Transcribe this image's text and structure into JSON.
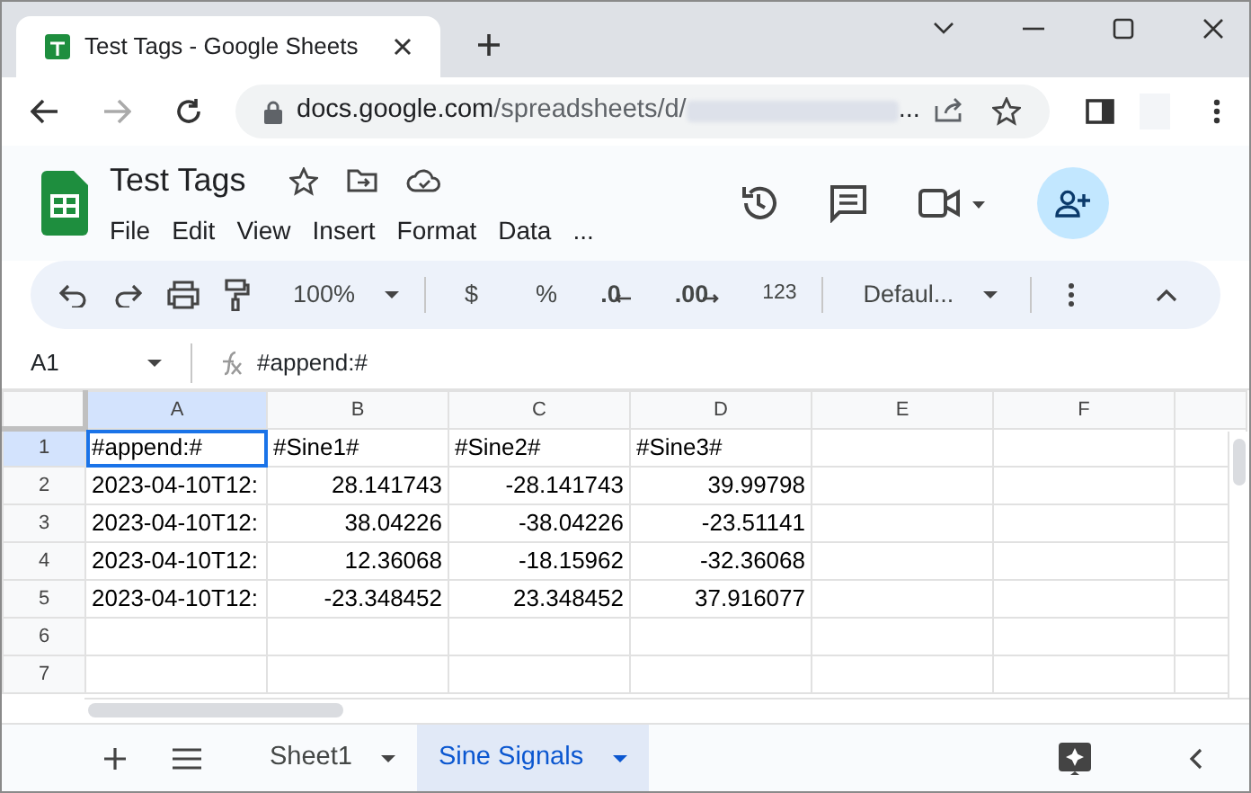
{
  "browser": {
    "tab_title": "Test Tags - Google Sheets",
    "url_host": "docs.google.com",
    "url_path": "/spreadsheets/d/",
    "url_ellipsis": "..."
  },
  "doc": {
    "title": "Test Tags",
    "menu": [
      "File",
      "Edit",
      "View",
      "Insert",
      "Format",
      "Data"
    ],
    "menu_more": "..."
  },
  "toolbar": {
    "zoom": "100%",
    "currency": "$",
    "percent": "%",
    "decrease_decimals": ".0",
    "increase_decimals": ".00",
    "number_format": "123",
    "font": "Defaul..."
  },
  "formula_bar": {
    "cell_ref": "A1",
    "formula": "#append:#"
  },
  "grid": {
    "columns": [
      {
        "label": "A",
        "selected": true
      },
      {
        "label": "B",
        "selected": false
      },
      {
        "label": "C",
        "selected": false
      },
      {
        "label": "D",
        "selected": false
      },
      {
        "label": "E",
        "selected": false
      },
      {
        "label": "F",
        "selected": false
      }
    ],
    "rows": [
      {
        "number": "1",
        "selected": true,
        "cells": [
          {
            "text": "#append:#",
            "kind": "text"
          },
          {
            "text": "#Sine1#",
            "kind": "text"
          },
          {
            "text": "#Sine2#",
            "kind": "text"
          },
          {
            "text": "#Sine3#",
            "kind": "text"
          }
        ]
      },
      {
        "number": "2",
        "selected": false,
        "cells": [
          {
            "text": "2023-04-10T12:",
            "kind": "text"
          },
          {
            "text": "28.141743",
            "kind": "number"
          },
          {
            "text": "-28.141743",
            "kind": "number"
          },
          {
            "text": "39.99798",
            "kind": "number"
          }
        ]
      },
      {
        "number": "3",
        "selected": false,
        "cells": [
          {
            "text": "2023-04-10T12:",
            "kind": "text"
          },
          {
            "text": "38.04226",
            "kind": "number"
          },
          {
            "text": "-38.04226",
            "kind": "number"
          },
          {
            "text": "-23.51141",
            "kind": "number"
          }
        ]
      },
      {
        "number": "4",
        "selected": false,
        "cells": [
          {
            "text": "2023-04-10T12:",
            "kind": "text"
          },
          {
            "text": "12.36068",
            "kind": "number"
          },
          {
            "text": "-18.15962",
            "kind": "number"
          },
          {
            "text": "-32.36068",
            "kind": "number"
          }
        ]
      },
      {
        "number": "5",
        "selected": false,
        "cells": [
          {
            "text": "2023-04-10T12:",
            "kind": "text"
          },
          {
            "text": "-23.348452",
            "kind": "number"
          },
          {
            "text": "23.348452",
            "kind": "number"
          },
          {
            "text": "37.916077",
            "kind": "number"
          }
        ]
      },
      {
        "number": "6",
        "selected": false,
        "cells": []
      },
      {
        "number": "7",
        "selected": false,
        "cells": []
      }
    ]
  },
  "sheet_tabs": [
    {
      "label": "Sheet1",
      "selected": false
    },
    {
      "label": "Sine Signals",
      "selected": true
    }
  ]
}
